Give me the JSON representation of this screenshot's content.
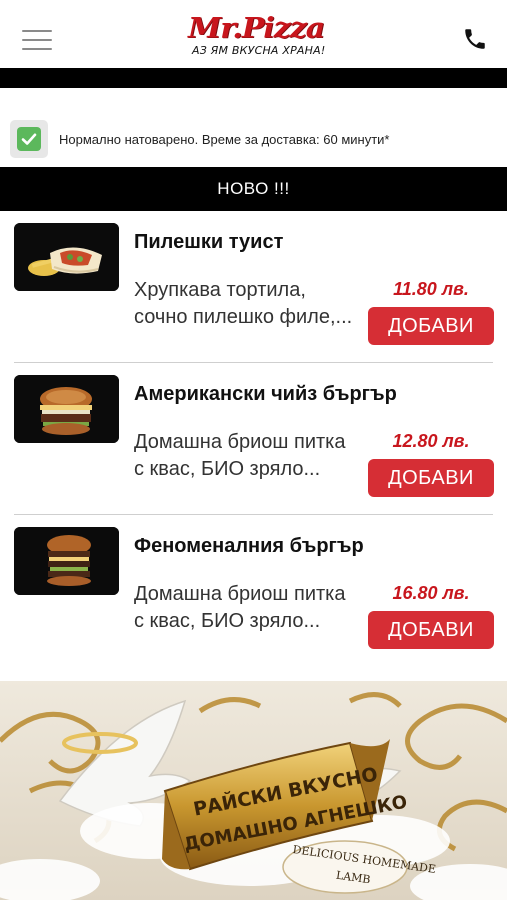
{
  "header": {
    "logo_text": "Mr.Pizza",
    "logo_tagline": "АЗ ЯМ ВКУСНА ХРАНА!",
    "menu_icon": "hamburger-menu-icon",
    "phone_icon": "phone-icon"
  },
  "status": {
    "checked": true,
    "text": "Нормално натоварено. Време за доставка: 60 минути*",
    "check_color": "#5cb85c"
  },
  "section": {
    "title": "НОВО !!!"
  },
  "products": [
    {
      "name": "Пилешки туист",
      "description": "Хрупкава тортила, сочно пилешко филе,...",
      "price": "11.80 лв.",
      "button": "ДОБАВИ"
    },
    {
      "name": "Американски чийз бъргър",
      "description": "Домашна бриош питка с квас, БИО зряло...",
      "price": "12.80 лв.",
      "button": "ДОБАВИ"
    },
    {
      "name": "Феноменалния бъргър",
      "description": "Домашна бриош питка с квас, БИО зряло...",
      "price": "16.80 лв.",
      "button": "ДОБАВИ"
    }
  ],
  "banner": {
    "title_line1": "РАЙСКИ ВКУСНО",
    "title_line2": "ДОМАШНО АГНЕШКО",
    "subtitle_line1": "DELICIOUS HOMEMADE",
    "subtitle_line2": "LAMB"
  },
  "colors": {
    "brand_red": "#c8161d",
    "button_red": "#d62e35",
    "bar_black": "#000000"
  }
}
